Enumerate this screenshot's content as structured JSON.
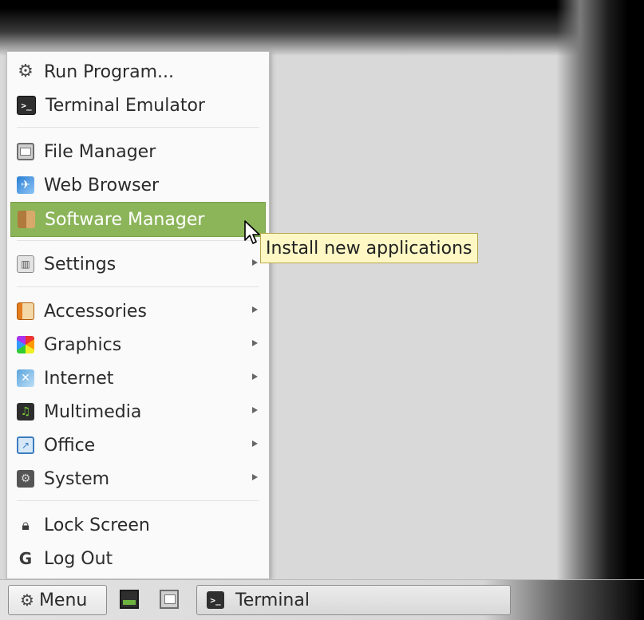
{
  "menu": {
    "group1": [
      {
        "label": "Run Program...",
        "icon": "gear-icon"
      },
      {
        "label": "Terminal Emulator",
        "icon": "terminal-icon"
      }
    ],
    "group2": [
      {
        "label": "File Manager",
        "icon": "file-manager-icon"
      },
      {
        "label": "Web Browser",
        "icon": "web-browser-icon"
      },
      {
        "label": "Software Manager",
        "icon": "software-manager-icon",
        "highlighted": true
      }
    ],
    "group3": [
      {
        "label": "Settings",
        "icon": "settings-icon",
        "submenu": true
      }
    ],
    "group4": [
      {
        "label": "Accessories",
        "icon": "accessories-icon",
        "submenu": true
      },
      {
        "label": "Graphics",
        "icon": "graphics-icon",
        "submenu": true
      },
      {
        "label": "Internet",
        "icon": "internet-icon",
        "submenu": true
      },
      {
        "label": "Multimedia",
        "icon": "multimedia-icon",
        "submenu": true
      },
      {
        "label": "Office",
        "icon": "office-icon",
        "submenu": true
      },
      {
        "label": "System",
        "icon": "system-icon",
        "submenu": true
      }
    ],
    "group5": [
      {
        "label": "Lock Screen",
        "icon": "lock-icon"
      },
      {
        "label": "Log Out",
        "icon": "logout-icon"
      }
    ]
  },
  "tooltip": {
    "text": "Install new applications"
  },
  "taskbar": {
    "menu_label": "Menu",
    "task_label": "Terminal"
  },
  "colors": {
    "highlight": "#8cb55a",
    "tooltip_bg": "#fff8c4",
    "desktop": "#d9d9d9"
  }
}
